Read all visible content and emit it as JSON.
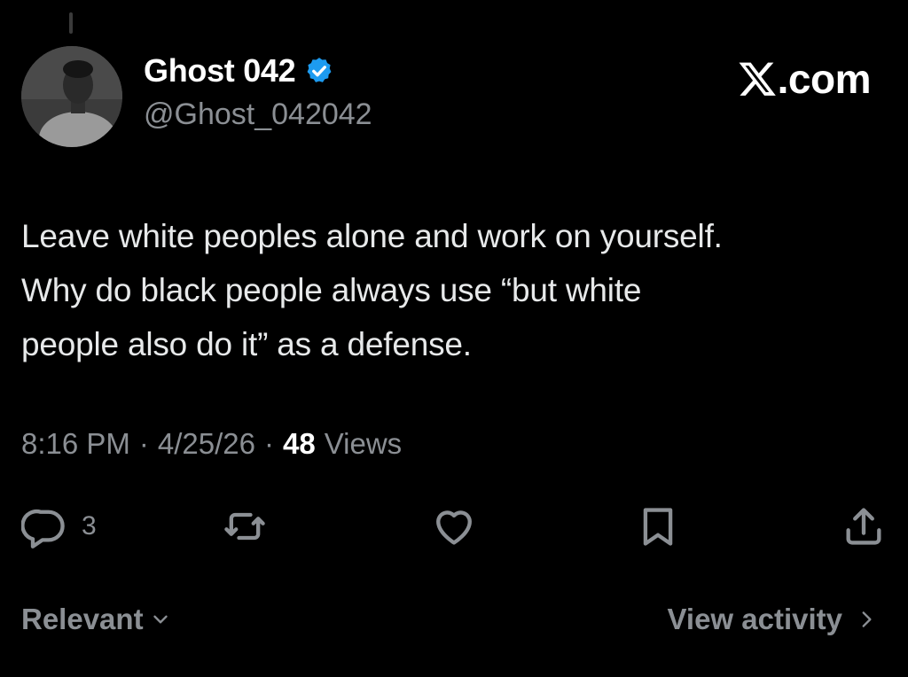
{
  "author": {
    "display_name": "Ghost 042",
    "handle": "@Ghost_042042",
    "verified": true,
    "verified_color": "#1d9bf0",
    "avatar_icon": "profile-photo"
  },
  "brand": {
    "icon": "x-logo-icon",
    "text": ".com"
  },
  "tweet": {
    "lines": [
      "Leave white peoples alone and work on yourself.",
      "Why do black people always use “but white",
      "people also do it” as a defense."
    ]
  },
  "meta": {
    "time": "8:16 PM",
    "separator": "·",
    "date": "4/25/26",
    "views_count": "48",
    "views_label": "Views"
  },
  "actions": {
    "reply": {
      "icon": "reply-icon",
      "count": "3"
    },
    "repost": {
      "icon": "repost-icon"
    },
    "like": {
      "icon": "heart-icon"
    },
    "bookmark": {
      "icon": "bookmark-icon"
    },
    "share": {
      "icon": "share-icon"
    }
  },
  "footer": {
    "sort_label": "Relevant",
    "sort_icon": "chevron-down-icon",
    "activity_label": "View activity",
    "activity_icon": "chevron-right-icon"
  },
  "colors": {
    "background": "#000000",
    "primary_text": "#e7e9ea",
    "secondary_text": "#8b8f94"
  }
}
